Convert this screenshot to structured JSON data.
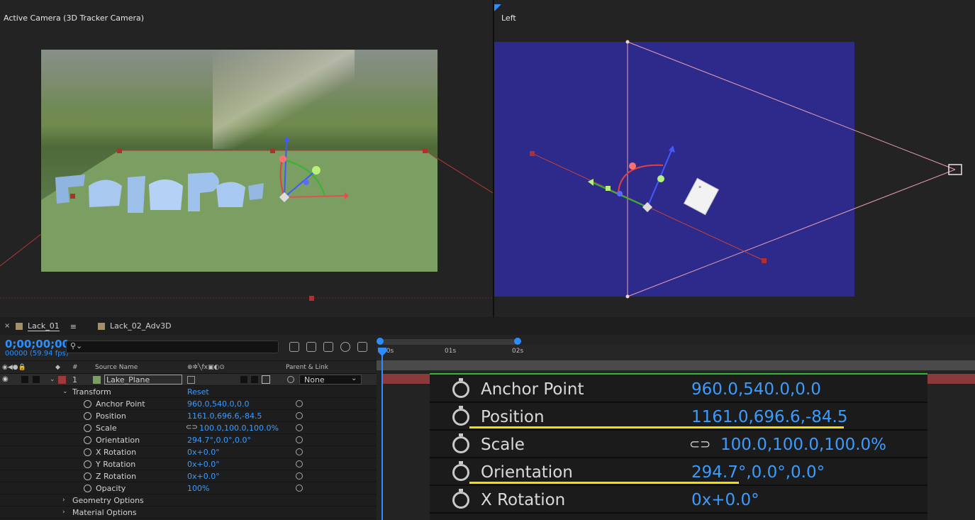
{
  "viewers": {
    "left_title": "Active Camera (3D Tracker Camera)",
    "right_title": "Left"
  },
  "tabs": [
    {
      "label": "Lack_01",
      "active": true
    },
    {
      "label": "Lack_02_Adv3D",
      "active": false
    }
  ],
  "timeline": {
    "timecode": "0;00;00;00",
    "frame_info": "00000 (59.94 fps)",
    "search_placeholder": "",
    "ruler_ticks": [
      "00s",
      "01s",
      "02s"
    ]
  },
  "columns": {
    "number": "#",
    "source_name": "Source Name",
    "parent_link": "Parent & Link"
  },
  "layer": {
    "index": "1",
    "name": "Lake_Plane",
    "parent": "None",
    "color": "#a03a3a"
  },
  "transform": {
    "label": "Transform",
    "reset": "Reset",
    "properties": [
      {
        "name": "Anchor Point",
        "value": "960.0,540.0,0.0"
      },
      {
        "name": "Position",
        "value": "1161.0,696.6,-84.5"
      },
      {
        "name": "Scale",
        "value": "100.0,100.0,100.0%"
      },
      {
        "name": "Orientation",
        "value": "294.7°,0.0°,0.0°"
      },
      {
        "name": "X Rotation",
        "value": "0x+0.0°"
      },
      {
        "name": "Y Rotation",
        "value": "0x+0.0°"
      },
      {
        "name": "Z Rotation",
        "value": "0x+0.0°"
      },
      {
        "name": "Opacity",
        "value": "100%"
      }
    ]
  },
  "groups": [
    "Geometry Options",
    "Material Options"
  ],
  "zoom_inset": [
    {
      "name": "Anchor Point",
      "value": "960.0,540.0,0.0"
    },
    {
      "name": "Position",
      "value": "1161.0,696.6,-84.5"
    },
    {
      "name": "Scale",
      "value": "100.0,100.0,100.0%"
    },
    {
      "name": "Orientation",
      "value": "294.7°,0.0°,0.0°"
    },
    {
      "name": "X Rotation",
      "value": "0x+0.0°"
    }
  ],
  "colors": {
    "accent": "#2c8fff",
    "highlight": "#f4de00",
    "plane": "#7a9e63",
    "left_view_bg": "#2e2a8c"
  }
}
